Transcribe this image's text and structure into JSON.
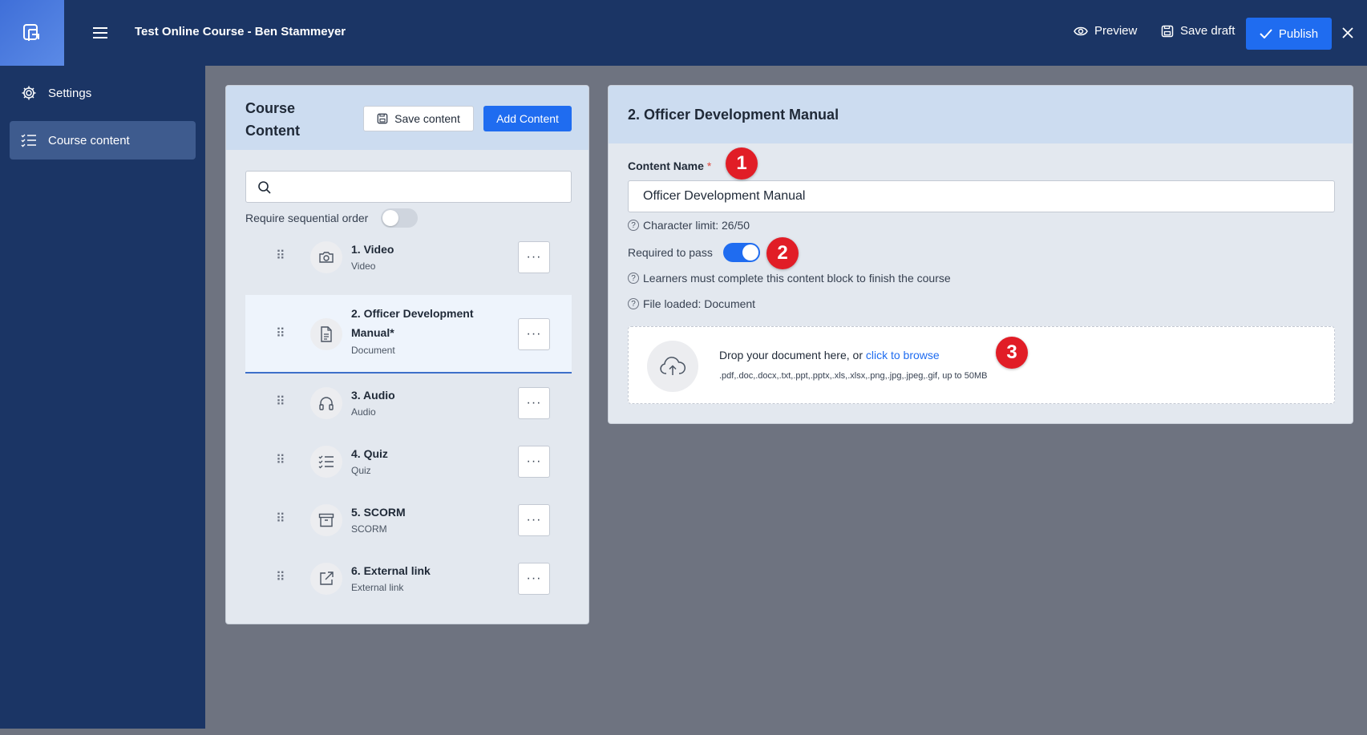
{
  "header": {
    "title": "Test Online Course - Ben Stammeyer",
    "preview_label": "Preview",
    "save_draft_label": "Save draft",
    "publish_label": "Publish"
  },
  "sidebar": {
    "items": [
      {
        "label": "Settings",
        "icon": "gear-icon",
        "active": false
      },
      {
        "label": "Course content",
        "icon": "list-checks-icon",
        "active": true
      }
    ]
  },
  "course_content": {
    "title": "Course Content",
    "save_content_label": "Save content",
    "add_content_label": "Add Content",
    "search": {
      "value": "",
      "placeholder": ""
    },
    "sequential_label": "Require sequential order",
    "sequential_on": false,
    "items": [
      {
        "name": "1. Video",
        "type": "Video",
        "icon": "camera-icon",
        "selected": false
      },
      {
        "name": "2. Officer Development Manual*",
        "type": "Document",
        "icon": "document-icon",
        "selected": true
      },
      {
        "name": "3. Audio",
        "type": "Audio",
        "icon": "headphones-icon",
        "selected": false
      },
      {
        "name": "4. Quiz",
        "type": "Quiz",
        "icon": "list-checks-icon",
        "selected": false
      },
      {
        "name": "5. SCORM",
        "type": "SCORM",
        "icon": "archive-icon",
        "selected": false
      },
      {
        "name": "6. External link",
        "type": "External link",
        "icon": "external-link-icon",
        "selected": false
      }
    ]
  },
  "editor": {
    "title": "2. Officer Development Manual",
    "content_name_label": "Content Name",
    "required_mark": "*",
    "content_name_value": "Officer Development Manual",
    "char_limit": "Character limit: 26/50",
    "required_to_pass_label": "Required to pass",
    "required_to_pass_on": true,
    "learners_help": "Learners must complete this content block to finish the course",
    "file_loaded": "File loaded: Document",
    "drop_text": "Drop your document here, or",
    "browse_link": "click to browse",
    "formats": ".pdf,.doc,.docx,.txt,.ppt,.pptx,.xls,.xlsx,.png,.jpg,.jpeg,.gif, up to 50MB"
  },
  "markers": [
    "1",
    "2",
    "3"
  ],
  "colors": {
    "topbar": "#1b3565",
    "accent": "#1f6cf0",
    "marker": "#e11d26",
    "panel_header": "#ccdcf0"
  }
}
